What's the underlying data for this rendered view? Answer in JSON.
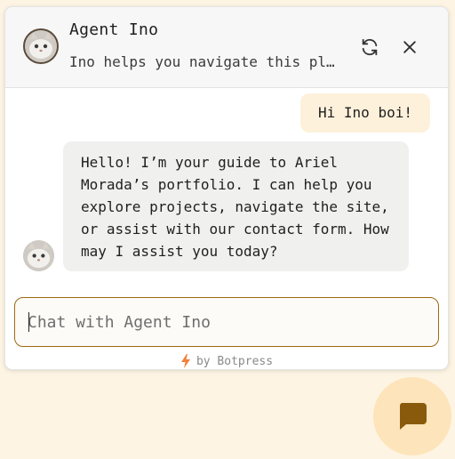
{
  "header": {
    "title": "Agent Ino",
    "subtitle": "Ino helps you navigate this pl…",
    "refresh_icon": "refresh-icon",
    "close_icon": "close-icon"
  },
  "messages": [
    {
      "sender": "user",
      "text": "Hi Ino boi!"
    },
    {
      "sender": "bot",
      "text": "Hello! I’m your guide to Ariel Morada’s portfolio. I can help you explore projects, navigate the site, or assist with our contact form. How may I assist you today?"
    }
  ],
  "composer": {
    "placeholder": "Chat with Agent Ino",
    "value": ""
  },
  "footer": {
    "text": "by Botpress",
    "icon": "bolt-icon"
  },
  "launcher": {
    "icon": "chat-bubble-icon"
  },
  "colors": {
    "page_background": "#fdf4e3",
    "accent": "#9a6a12",
    "user_bubble": "#fdf1db",
    "bot_bubble": "#f0f0ef",
    "launcher_bg": "#fde4ba",
    "launcher_icon": "#8a5a0c",
    "bolt": "#f0803a"
  }
}
